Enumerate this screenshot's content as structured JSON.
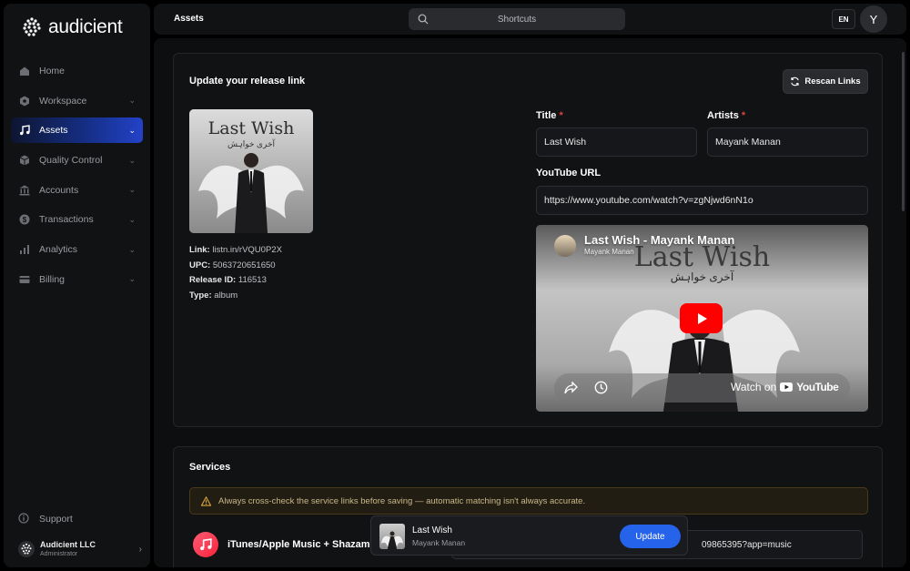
{
  "brand": {
    "name": "audicient"
  },
  "sidebar": {
    "items": [
      {
        "label": "Home",
        "icon": "home-icon",
        "has_chevron": false
      },
      {
        "label": "Workspace",
        "icon": "workspace-icon",
        "has_chevron": true
      },
      {
        "label": "Assets",
        "icon": "music-note-icon",
        "has_chevron": true,
        "active": true
      },
      {
        "label": "Quality Control",
        "icon": "cube-icon",
        "has_chevron": true
      },
      {
        "label": "Accounts",
        "icon": "bank-icon",
        "has_chevron": true
      },
      {
        "label": "Transactions",
        "icon": "dollar-circle-icon",
        "has_chevron": true
      },
      {
        "label": "Analytics",
        "icon": "bar-chart-icon",
        "has_chevron": true
      },
      {
        "label": "Billing",
        "icon": "card-icon",
        "has_chevron": true
      }
    ],
    "support": "Support",
    "org": {
      "name": "Audicient LLC",
      "role": "Administrator"
    }
  },
  "header": {
    "title": "Assets",
    "search_placeholder": "Shortcuts",
    "lang": "EN",
    "user_initial": "Y"
  },
  "release": {
    "card_title": "Update your release link",
    "rescan_label": "Rescan Links",
    "meta": {
      "link_label": "Link:",
      "link_value": "listn.in/rVQU0P2X",
      "upc_label": "UPC:",
      "upc_value": "5063720651650",
      "release_id_label": "Release ID:",
      "release_id_value": "116513",
      "type_label": "Type:",
      "type_value": "album"
    },
    "cover": {
      "title": "Last Wish",
      "subtitle": "آخری خواہش"
    },
    "form": {
      "title_label": "Title",
      "title_value": "Last Wish",
      "artists_label": "Artists",
      "artists_value": "Mayank Manan",
      "youtube_label": "YouTube URL",
      "youtube_value": "https://www.youtube.com/watch?v=zgNjwd6nN1o",
      "required_mark": "*"
    },
    "video": {
      "title": "Last Wish - Mayank Manan",
      "channel": "Mayank Manan",
      "watch_on": "Watch on",
      "platform": "YouTube"
    }
  },
  "services": {
    "title": "Services",
    "warning": "Always cross-check the service links before saving — automatic matching isn't always accurate.",
    "items": [
      {
        "name": "iTunes/Apple Music + Shazam",
        "url_fragment": "09865395?app=music",
        "icon": "apple-music-icon"
      }
    ]
  },
  "update_bar": {
    "title": "Last Wish",
    "artist": "Mayank Manan",
    "button": "Update"
  },
  "colors": {
    "accent": "#2563eb",
    "active_nav_start": "#0d1530",
    "active_nav_end": "#2342c8",
    "youtube_red": "#ff0000",
    "required": "#e0413b"
  }
}
